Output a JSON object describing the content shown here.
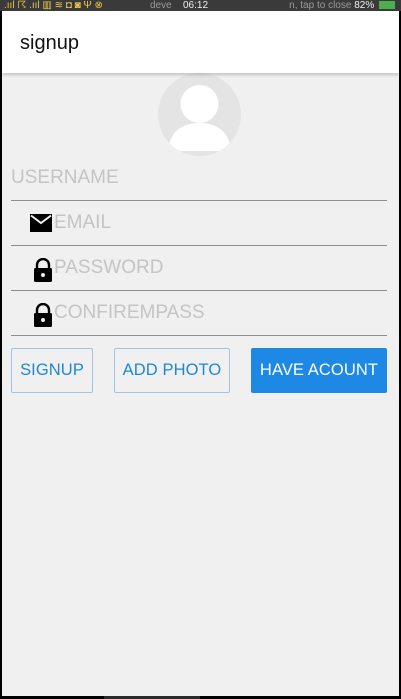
{
  "status_bar": {
    "left_icons": ".ııl ☈ .ııl ▥ ≋ ◘ ◙ Ψ ⊗",
    "notice": "deve",
    "time": "06:12",
    "notice_tail": "n, tap to close",
    "battery": "82%"
  },
  "app_bar": {
    "title": "signup"
  },
  "form": {
    "username_placeholder": "USERNAME",
    "email_placeholder": "EMAIL",
    "password_placeholder": "PASSWORD",
    "confirm_placeholder": "CONFIREMPASS"
  },
  "buttons": {
    "signup": "SIGNUP",
    "add_photo": "ADD PHOTO",
    "have_account": "HAVE ACOUNT"
  },
  "icons": {
    "avatar": "person-placeholder-icon",
    "email": "mail-icon",
    "password": "lock-icon",
    "confirm": "lock-icon"
  },
  "colors": {
    "accent": "#1e88e5",
    "background": "#eff0ef",
    "placeholder": "#c4c4c4"
  }
}
